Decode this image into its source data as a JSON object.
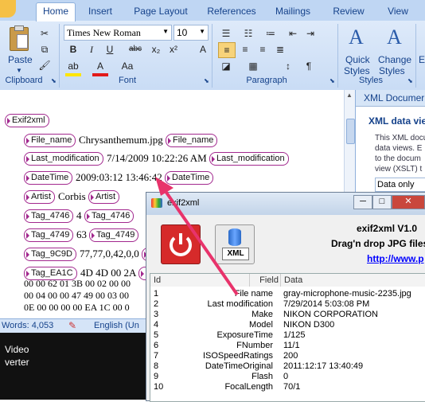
{
  "ribbon": {
    "tabs": [
      "Home",
      "Insert",
      "Page Layout",
      "References",
      "Mailings",
      "Review",
      "View"
    ],
    "active_tab": "Home",
    "clipboard": {
      "paste_label": "Paste",
      "group_label": "Clipboard"
    },
    "font": {
      "name": "Times New Roman",
      "size": "10",
      "group_label": "Font"
    },
    "paragraph": {
      "group_label": "Paragraph"
    },
    "styles": {
      "quick_styles": "Quick Styles",
      "change_styles": "Change Styles",
      "group_label": "Styles",
      "quick_line1": "Quick",
      "quick_line2": "Styles",
      "change_line1": "Change",
      "change_line2": "Styles",
      "edit_partial": "Ed"
    }
  },
  "document": {
    "root_tag": "Exif2xml",
    "rows": [
      {
        "tag": "File_name",
        "value": "Chrysanthemum.jpg"
      },
      {
        "tag": "Last_modification",
        "value": "7/14/2009 10:22:26 AM"
      },
      {
        "tag": "DateTime",
        "value": "2009:03:12 13:46:42"
      },
      {
        "tag": "Artist",
        "value": "Corbis"
      },
      {
        "tag": "Tag_4746",
        "value": "4"
      },
      {
        "tag": "Tag_4749",
        "value": "63"
      },
      {
        "tag": "Tag_9C9D",
        "value": "77,77,0,42,0,0"
      },
      {
        "tag": "Tag_EA1C",
        "value": "4D 4D 00 2A"
      }
    ],
    "hex_lines": [
      "00 00 62 01 3B 00 02 00 00",
      "00 04 00 00 47 49 00 03 00",
      "0E 00 00 00 00 EA 1C 00 0"
    ]
  },
  "xml_pane": {
    "title": "XML Documer",
    "subtitle": "XML data vie",
    "text_lines": [
      "This XML docu",
      "data views. E",
      "to the docum",
      "view (XSLT) t"
    ],
    "dropdown": "Data only"
  },
  "status": {
    "words": "Words: 4,053",
    "language": "English (Un"
  },
  "taskbar": {
    "line1": "Video",
    "line2": "verter"
  },
  "app": {
    "title": "exif2xml",
    "version": "exif2xml V1.0",
    "hint": "Drag'n drop JPG files",
    "link": "http://www.p",
    "xml_button": "XML",
    "columns": [
      "Id",
      "Field",
      "Data"
    ],
    "rows": [
      {
        "id": "1",
        "field": "File name",
        "data": "gray-microphone-music-2235.jpg"
      },
      {
        "id": "2",
        "field": "Last modification",
        "data": "7/29/2014 5:03:08 PM"
      },
      {
        "id": "3",
        "field": "Make",
        "data": "NIKON CORPORATION"
      },
      {
        "id": "4",
        "field": "Model",
        "data": "NIKON D300"
      },
      {
        "id": "5",
        "field": "ExposureTime",
        "data": "1/125"
      },
      {
        "id": "6",
        "field": "FNumber",
        "data": "11/1"
      },
      {
        "id": "7",
        "field": "ISOSpeedRatings",
        "data": "200"
      },
      {
        "id": "8",
        "field": "DateTimeOriginal",
        "data": "2011:12:17 13:40:49"
      },
      {
        "id": "9",
        "field": "Flash",
        "data": "0"
      },
      {
        "id": "10",
        "field": "FocalLength",
        "data": "70/1"
      }
    ]
  },
  "colors": {
    "tag_border": "#a2288e",
    "arrow": "#e8336b",
    "ribbon_text": "#15428b",
    "power_button": "#d62a2a"
  }
}
